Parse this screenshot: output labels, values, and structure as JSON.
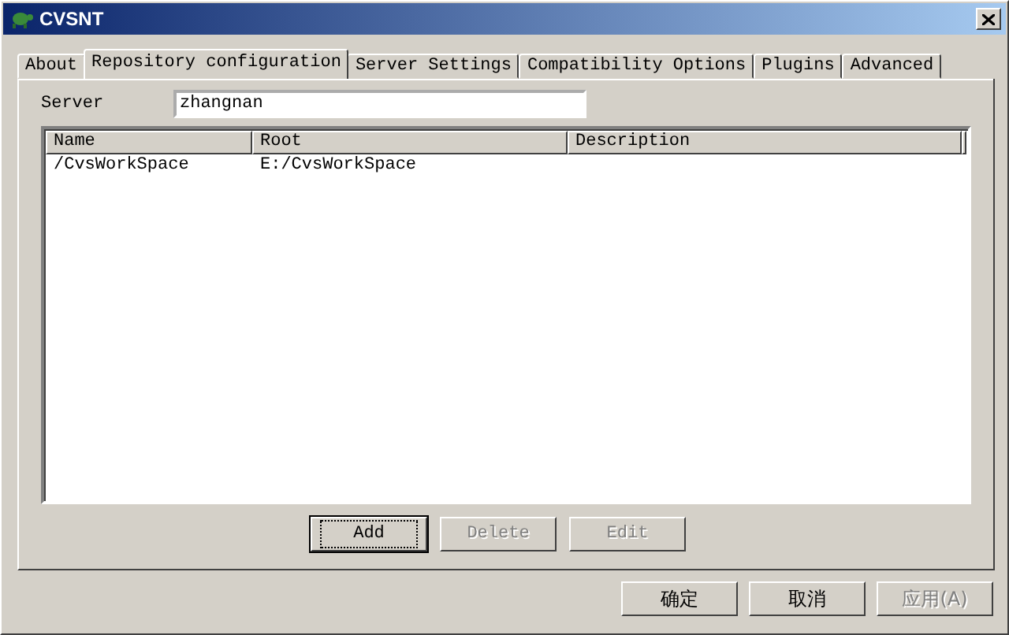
{
  "window": {
    "title": "CVSNT"
  },
  "tabs": [
    {
      "label": "About",
      "selected": false
    },
    {
      "label": "Repository configuration",
      "selected": true
    },
    {
      "label": "Server Settings",
      "selected": false
    },
    {
      "label": "Compatibility Options",
      "selected": false
    },
    {
      "label": "Plugins",
      "selected": false
    },
    {
      "label": "Advanced",
      "selected": false
    }
  ],
  "server": {
    "label": "Server",
    "value": "zhangnan"
  },
  "table": {
    "columns": [
      "Name",
      "Root",
      "Description"
    ],
    "rows": [
      [
        "/CvsWorkSpace",
        "E:/CvsWorkSpace",
        ""
      ]
    ]
  },
  "list_buttons": [
    {
      "label": "Add",
      "disabled": false,
      "default": true
    },
    {
      "label": "Delete",
      "disabled": true,
      "default": false
    },
    {
      "label": "Edit",
      "disabled": true,
      "default": false
    }
  ],
  "dialog_buttons": [
    {
      "label": "确定",
      "disabled": false
    },
    {
      "label": "取消",
      "disabled": false
    },
    {
      "label": "应用(A)",
      "disabled": true
    }
  ]
}
